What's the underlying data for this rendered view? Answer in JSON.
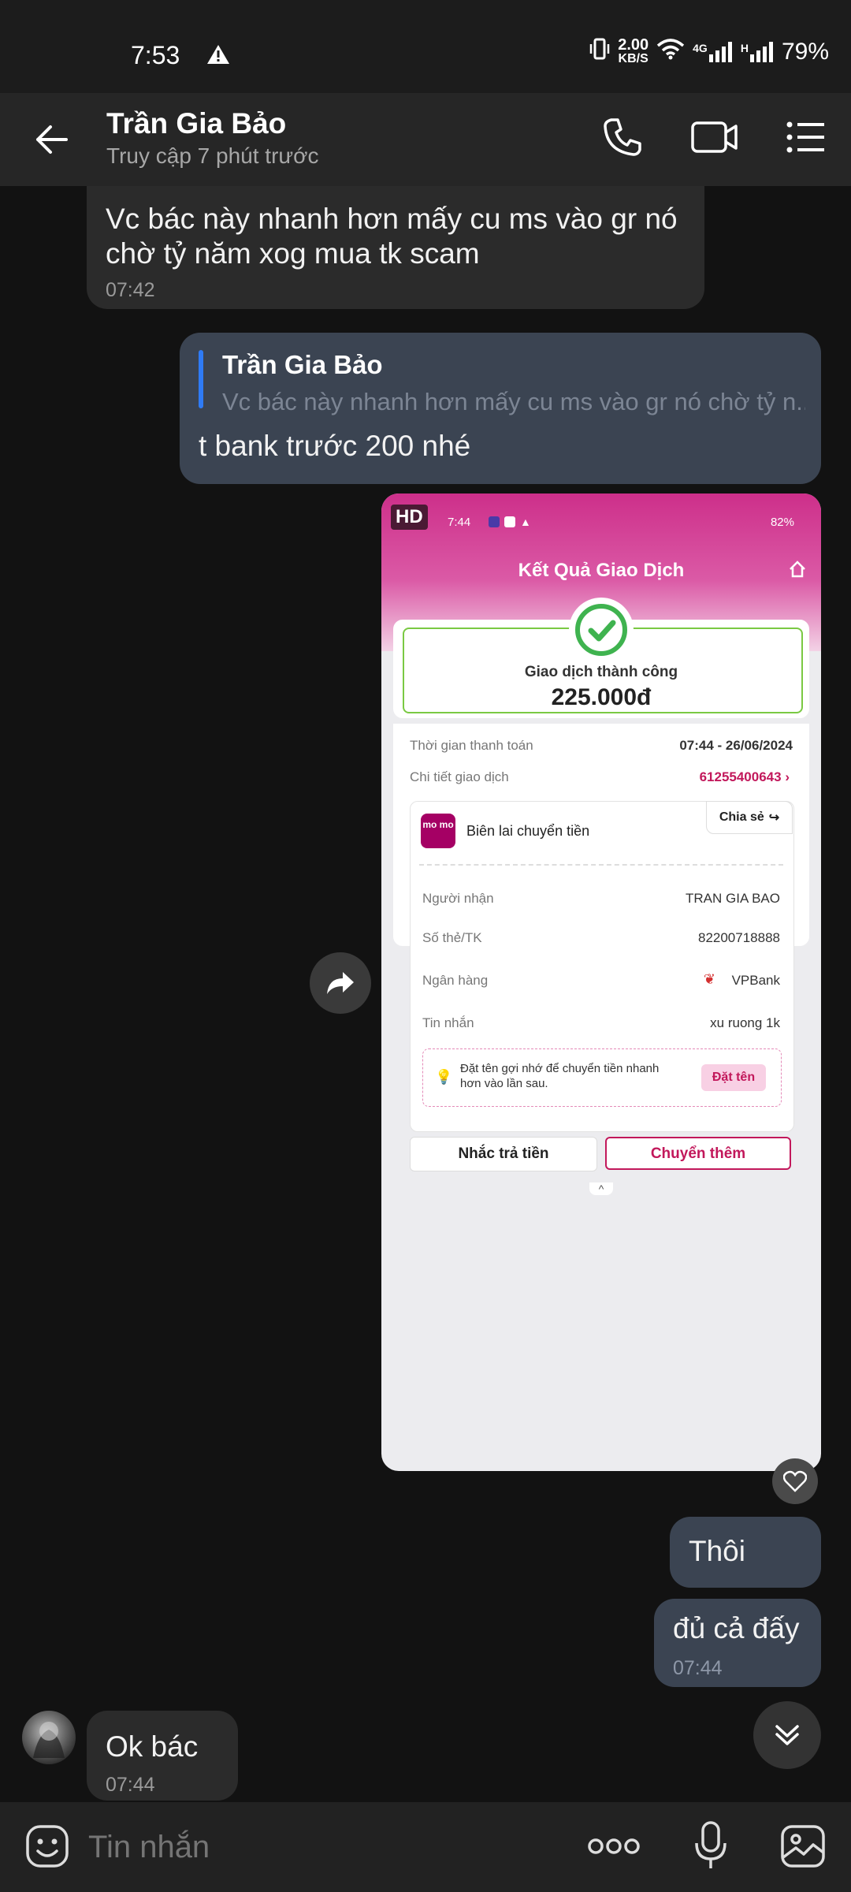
{
  "status_bar": {
    "time": "7:53",
    "net_speed_value": "2.00",
    "net_speed_unit": "KB/S",
    "network": "4G",
    "network2": "H",
    "battery": "79%"
  },
  "header": {
    "name": "Trần Gia Bảo",
    "last_seen": "Truy cập 7 phút trước"
  },
  "messages": {
    "m1": {
      "text": "Vc bác này nhanh hơn mấy cu ms vào gr nó chờ tỷ năm xog mua tk scam",
      "time": "07:42"
    },
    "m2": {
      "reply_name": "Trần Gia Bảo",
      "reply_text": "Vc bác này nhanh hơn mấy cu ms vào gr nó chờ tỷ n...",
      "text": "t bank trước 200 nhé"
    },
    "m4": {
      "text": "Thôi"
    },
    "m5": {
      "text": "đủ cả đấy",
      "time": "07:44"
    },
    "m6": {
      "text": "Ok bác",
      "time": "07:44"
    }
  },
  "receipt": {
    "hd": "HD",
    "inner_time": "7:44",
    "inner_battery": "82%",
    "title": "Kết Quả Giao Dịch",
    "success": "Giao dịch thành công",
    "amount": "225.000đ",
    "pay_time_label": "Thời gian thanh toán",
    "pay_time": "07:44 - 26/06/2024",
    "detail_label": "Chi tiết giao dịch",
    "detail_value": "61255400643",
    "momo_logo": "mo mo",
    "receipt_label": "Biên lai chuyển tiền",
    "share": "Chia sẻ",
    "recipient_label": "Người nhận",
    "recipient": "TRAN GIA BAO",
    "account_label": "Số thẻ/TK",
    "account": "82200718888",
    "bank_label": "Ngân hàng",
    "bank": "VPBank",
    "message_label": "Tin nhắn",
    "message": "xu ruong 1k",
    "tip": "Đặt tên gợi nhớ để chuyển tiền nhanh hơn vào lần sau.",
    "tip_button": "Đặt tên",
    "remind_button": "Nhắc trả tiền",
    "more_button": "Chuyển thêm"
  },
  "composer": {
    "placeholder": "Tin nhắn"
  },
  "colors": {
    "accent": "#c2185b",
    "momo": "#a50064",
    "outgoing": "#3b4452",
    "incoming": "#2b2b2b",
    "reply_bar": "#2f7bf5"
  }
}
